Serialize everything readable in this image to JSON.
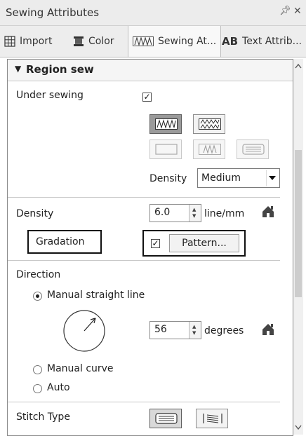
{
  "window": {
    "title": "Sewing Attributes",
    "pin_glyph": "⊕",
    "close_glyph": "✕"
  },
  "tabs": [
    {
      "label": "Import"
    },
    {
      "label": "Color"
    },
    {
      "label": "Sewing At..."
    },
    {
      "label": "Text Attrib..."
    }
  ],
  "section": {
    "title": "Region sew",
    "arrow": "▼"
  },
  "under_sewing": {
    "label": "Under sewing",
    "checked": true,
    "density_label": "Density",
    "density_value": "Medium"
  },
  "density": {
    "label": "Density",
    "value": "6.0",
    "unit": "line/mm"
  },
  "gradation": {
    "label": "Gradation",
    "checked": true,
    "button_label": "Pattern..."
  },
  "direction": {
    "label": "Direction",
    "options": [
      {
        "label": "Manual straight line",
        "selected": true
      },
      {
        "label": "Manual curve",
        "selected": false
      },
      {
        "label": "Auto",
        "selected": false
      }
    ],
    "angle_value": "56",
    "angle_unit": "degrees"
  },
  "stitch_type": {
    "label": "Stitch Type"
  },
  "icons": [
    "house-icon",
    "stitch-pattern-icon",
    "grid-icon",
    "spool-icon",
    "fill-pattern-icon"
  ]
}
